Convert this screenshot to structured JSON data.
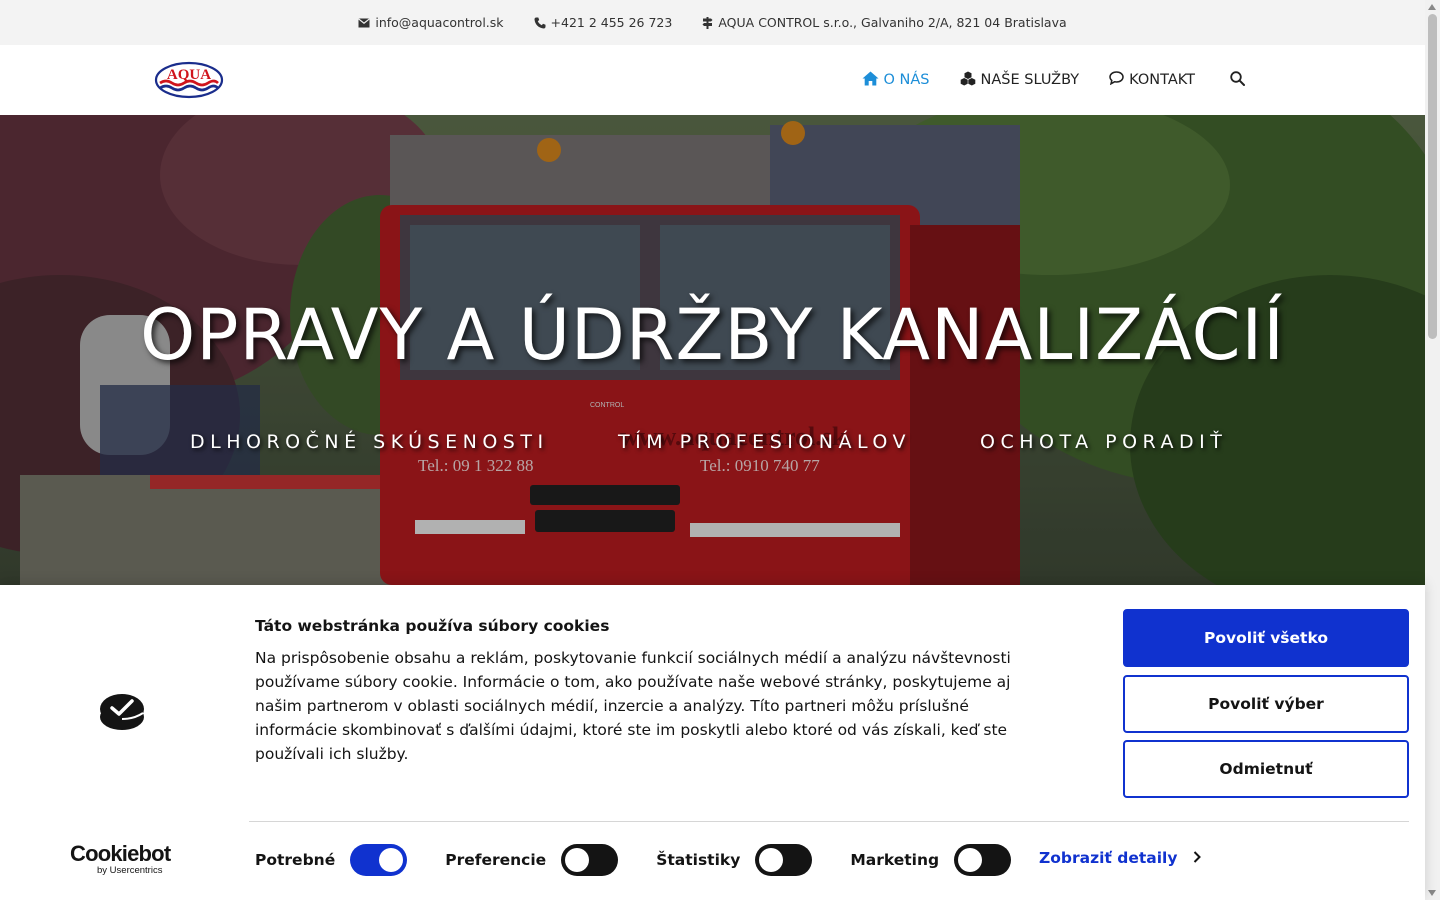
{
  "topbar": {
    "email": "info@aquacontrol.sk",
    "phone": "+421 2 455 26 723",
    "address": "AQUA CONTROL s.r.o., Galvaniho 2/A, 821 04 Bratislava"
  },
  "header": {
    "logo_text": "AQUA",
    "nav": [
      {
        "label": "O NÁS",
        "icon": "home-icon",
        "active": true
      },
      {
        "label": "NAŠE SLUŽBY",
        "icon": "cubes-icon",
        "active": false
      },
      {
        "label": "KONTAKT",
        "icon": "comment-icon",
        "active": false
      }
    ]
  },
  "hero": {
    "title": "OPRAVY A ÚDRŽBY KANALIZÁCIÍ",
    "taglines": [
      "DLHOROČNÉ SKÚSENOSTI",
      "TÍM PROFESIONÁLOV",
      "OCHOTA PORADIŤ"
    ],
    "photo_text": {
      "web": "www.aquacontrol.sk",
      "phone_left": "Tel.: 09 1 322 88",
      "phone_right": "Tel.: 0910 740 77",
      "badge": "CONTROL"
    }
  },
  "cookie": {
    "title": "Táto webstránka používa súbory cookies",
    "text": "Na prispôsobenie obsahu a reklám, poskytovanie funkcií sociálnych médií a analýzu návštevnosti používame súbory cookie. Informácie o tom, ako používate naše webové stránky, poskytujeme aj našim partnerom v oblasti sociálnych médií, inzercie a analýzy. Títo partneri môžu príslušné informácie skombinovať s ďalšími údajmi, ktoré ste im poskytli alebo ktoré od vás získali, keď ste používali ich služby.",
    "buttons": {
      "allow_all": "Povoliť všetko",
      "allow_selection": "Povoliť výber",
      "deny": "Odmietnuť"
    },
    "toggles": [
      {
        "label": "Potrebné",
        "on": true
      },
      {
        "label": "Preferencie",
        "on": false
      },
      {
        "label": "Štatistiky",
        "on": false
      },
      {
        "label": "Marketing",
        "on": false
      }
    ],
    "details_link": "Zobraziť detaily",
    "brand": {
      "name": "Cookiebot",
      "by": "by Usercentrics"
    }
  },
  "colors": {
    "accent": "#1032cf",
    "nav_active": "#1d8ed8",
    "topbar_bg": "#f3f3f3"
  }
}
